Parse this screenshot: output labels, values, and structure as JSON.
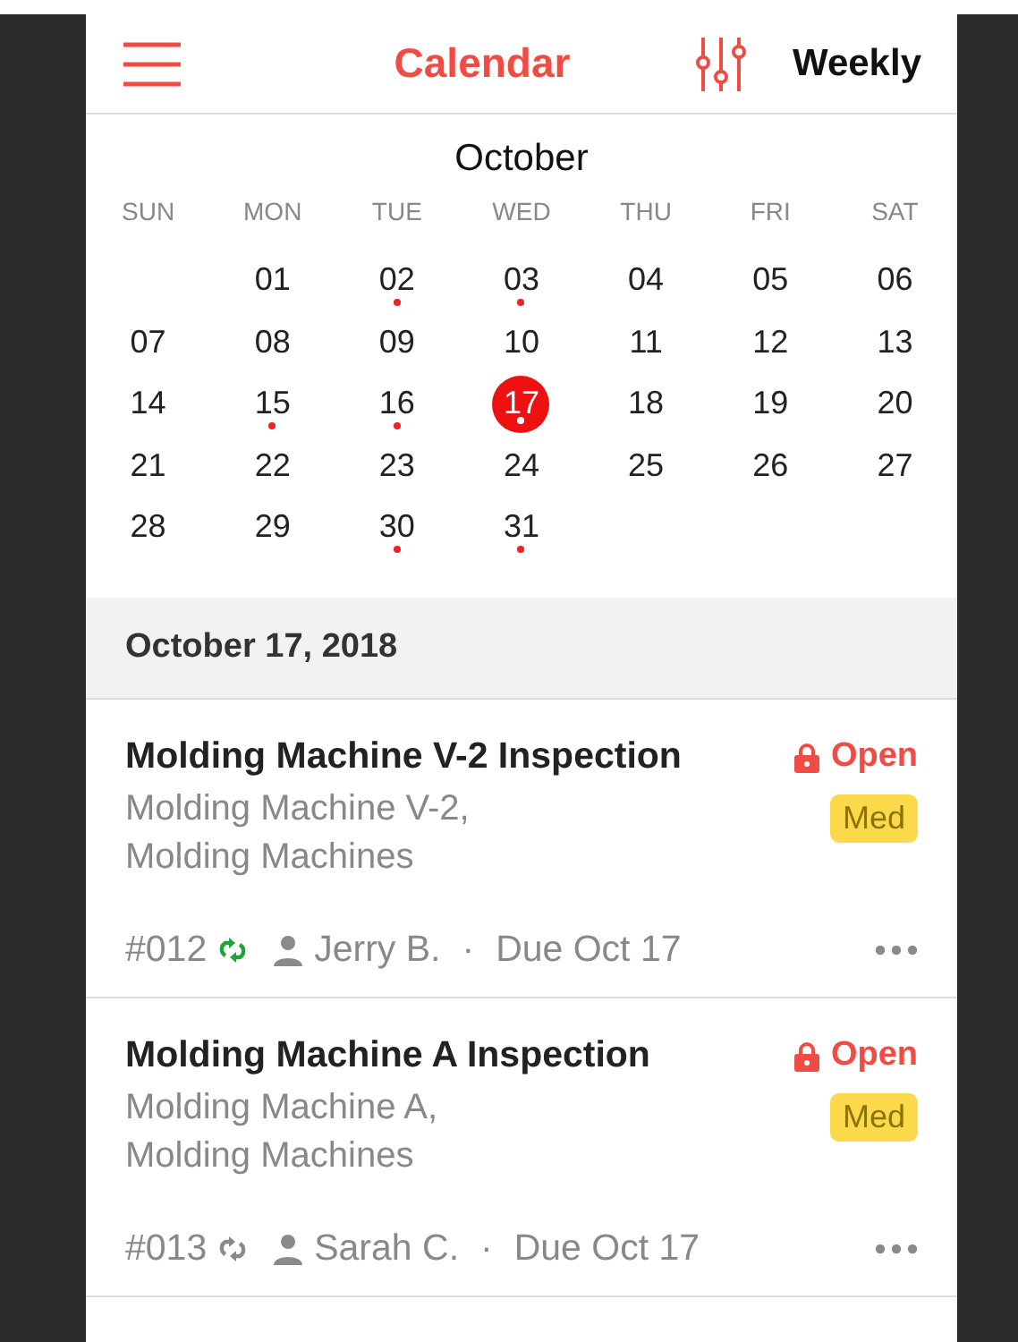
{
  "header": {
    "title": "Calendar",
    "view": "Weekly"
  },
  "calendar": {
    "month": "October",
    "weekdays": [
      "SUN",
      "MON",
      "TUE",
      "WED",
      "THU",
      "FRI",
      "SAT"
    ],
    "weeks": [
      {
        "days": [
          {
            "day": "01",
            "has_event": false,
            "selected": false
          },
          {
            "day": "02",
            "has_event": true,
            "selected": false
          },
          {
            "day": "03",
            "has_event": true,
            "selected": false
          },
          {
            "day": "04",
            "has_event": false,
            "selected": false
          },
          {
            "day": "05",
            "has_event": false,
            "selected": false
          },
          {
            "day": "06",
            "has_event": false,
            "selected": false
          }
        ]
      },
      {
        "days": [
          {
            "day": "07",
            "has_event": false,
            "selected": false
          },
          {
            "day": "08",
            "has_event": false,
            "selected": false
          },
          {
            "day": "09",
            "has_event": false,
            "selected": false
          },
          {
            "day": "10",
            "has_event": false,
            "selected": false
          },
          {
            "day": "11",
            "has_event": false,
            "selected": false
          },
          {
            "day": "12",
            "has_event": false,
            "selected": false
          },
          {
            "day": "13",
            "has_event": false,
            "selected": false
          }
        ]
      },
      {
        "days": [
          {
            "day": "14",
            "has_event": false,
            "selected": false
          },
          {
            "day": "15",
            "has_event": true,
            "selected": false
          },
          {
            "day": "16",
            "has_event": true,
            "selected": false
          },
          {
            "day": "17",
            "has_event": true,
            "selected": true
          },
          {
            "day": "18",
            "has_event": false,
            "selected": false
          },
          {
            "day": "19",
            "has_event": false,
            "selected": false
          },
          {
            "day": "20",
            "has_event": false,
            "selected": false
          }
        ]
      },
      {
        "days": [
          {
            "day": "21",
            "has_event": false,
            "selected": false
          },
          {
            "day": "22",
            "has_event": false,
            "selected": false
          },
          {
            "day": "23",
            "has_event": false,
            "selected": false
          },
          {
            "day": "24",
            "has_event": false,
            "selected": false
          },
          {
            "day": "25",
            "has_event": false,
            "selected": false
          },
          {
            "day": "26",
            "has_event": false,
            "selected": false
          },
          {
            "day": "27",
            "has_event": false,
            "selected": false
          }
        ]
      },
      {
        "days": [
          {
            "day": "28",
            "has_event": false,
            "selected": false
          },
          {
            "day": "29",
            "has_event": false,
            "selected": false
          },
          {
            "day": "30",
            "has_event": true,
            "selected": false
          },
          {
            "day": "31",
            "has_event": true,
            "selected": false
          }
        ]
      }
    ]
  },
  "date_heading": "October 17, 2018",
  "work_orders": [
    {
      "title": "Molding Machine V-2 Inspection",
      "status": "Open",
      "location": [
        "Molding Machine V-2,",
        "Molding Machines"
      ],
      "priority": "Med",
      "number": "#012",
      "repeat_active": true,
      "assignee": "Jerry B.",
      "separator": "·",
      "due": "Due Oct 17"
    },
    {
      "title": "Molding Machine A Inspection",
      "status": "Open",
      "location": [
        "Molding Machine A,",
        "Molding Machines"
      ],
      "priority": "Med",
      "number": "#013",
      "repeat_active": false,
      "assignee": "Sarah C.",
      "separator": "·",
      "due": "Due Oct 17"
    }
  ]
}
